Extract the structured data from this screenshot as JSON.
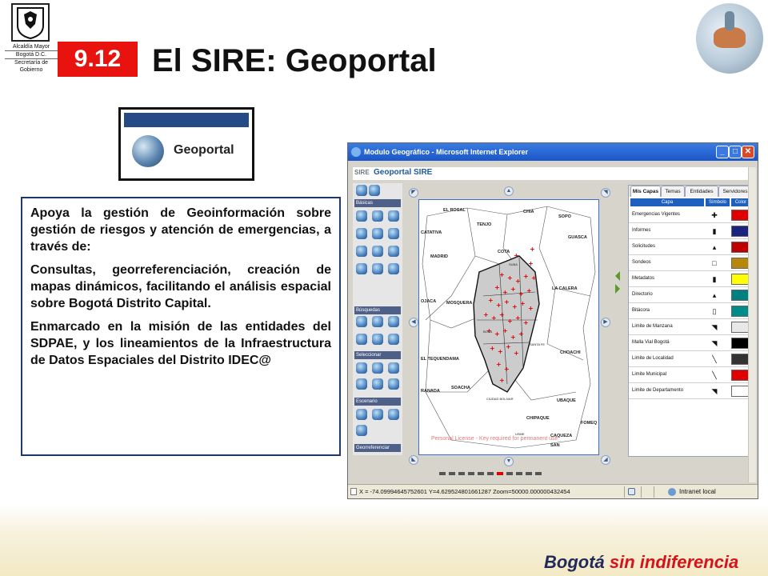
{
  "header": {
    "agency_lines": [
      "Alcaldía Mayor",
      "Bogotá D.C.",
      "Secretaría de Gobierno"
    ],
    "section_number": "9.12",
    "title": "El SIRE: Geoportal"
  },
  "geoportal_logo": {
    "label": "Geoportal"
  },
  "textbox": {
    "p1": "Apoya la  gestión de Geoinformación sobre  gestión de riesgos y atención de emergencias, a través de:",
    "p2": "Consultas, georreferenciación, creación de mapas dinámicos, facilitando el análisis espacial sobre Bogotá Distrito Capital.",
    "p3": "Enmarcado en la misión de las entidades del SDPAE, y los lineamientos de la Infraestructura de Datos Espaciales del Distrito IDEC@"
  },
  "window": {
    "title": "Modulo Geográfico - Microsoft Internet Explorer",
    "app_logo": "SIRE",
    "app_name": "Geoportal SIRE",
    "sections": [
      "Básicas",
      "Búsquedas",
      "Seleccionar",
      "Escenario",
      "Georreferenciar"
    ],
    "tabs": [
      "Mis Capas",
      "Temas",
      "Entidades",
      "Servidores"
    ],
    "layer_headers": [
      "Capa",
      "Símbolo",
      "Color"
    ],
    "layers": [
      {
        "name": "Emergencias Vigentes",
        "symbol": "✚",
        "color": "#e00000"
      },
      {
        "name": "Informes",
        "symbol": "▮",
        "color": "#1a237e"
      },
      {
        "name": "Solicitudes",
        "symbol": "▴",
        "color": "#c00000"
      },
      {
        "name": "Sondeos",
        "symbol": "□",
        "color": "#b8860b"
      },
      {
        "name": "Metadatos",
        "symbol": "▮",
        "color": "#ffff00"
      },
      {
        "name": "Directorio",
        "symbol": "▴",
        "color": "#008080"
      },
      {
        "name": "Bitácora",
        "symbol": "▯",
        "color": "#008b8b"
      },
      {
        "name": "Limite de Manzana",
        "symbol": "◥",
        "color": "#e8e8e8"
      },
      {
        "name": "Malla Vial Bogotá",
        "symbol": "◥",
        "color": "#000000"
      },
      {
        "name": "Limite de Localidad",
        "symbol": "╲",
        "color": "#333333"
      },
      {
        "name": "Limite Municipal",
        "symbol": "╲",
        "color": "#e00000"
      },
      {
        "name": "Limite de Departamento",
        "symbol": "◥",
        "color": "#ffffff"
      }
    ],
    "map_labels": [
      "EL ROSAL",
      "CHIA",
      "SOPO",
      "TENJO",
      "GUASCA",
      "CATATIVA",
      "MADRID",
      "COTA",
      "LA CALERA",
      "OJACA",
      "MOSQUERA",
      "EL TEQUENDAMA",
      "RANADA",
      "SOACHA",
      "CHOACHI",
      "UBAQUE",
      "CHIPAQUE",
      "FOMEQ",
      "CAQUEZA",
      "SAN",
      "SUBA",
      "BOSA",
      "SANTA FE",
      "CIUDAD BOLIVAR",
      "USME"
    ],
    "map_watermark": "Personal License - Key required for permanent use",
    "status_coords": "X = -74.09994645752601  Y=4.629524801661287  Zoom=50000.000000432454",
    "status_zone": "Intranet local"
  },
  "footer": {
    "brand_part1": "Bogotá ",
    "brand_part2": "sin indiferencia"
  },
  "colors": {
    "badge": "#e8130f",
    "text_border": "#1d3a6a",
    "footer_accent": "#d4141a"
  }
}
